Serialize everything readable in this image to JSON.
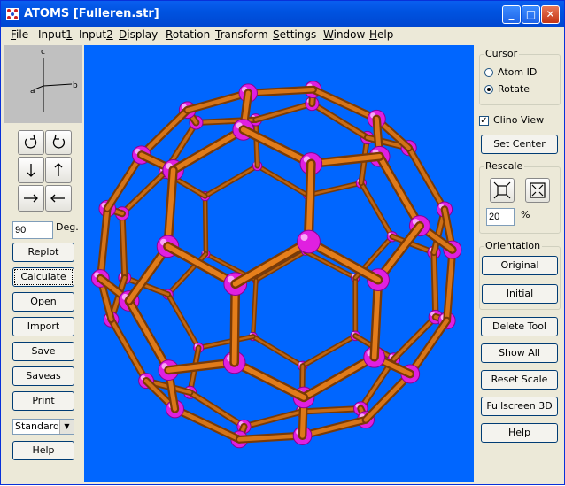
{
  "window": {
    "title": "ATOMS [Fulleren.str]"
  },
  "menu": [
    "File",
    "Input1",
    "Input2",
    "Display",
    "Rotation",
    "Transform",
    "Settings",
    "Window",
    "Help"
  ],
  "menu_underline": [
    "F",
    "1",
    "2",
    "D",
    "R",
    "T",
    "S",
    "W",
    "H"
  ],
  "axes": {
    "a": "a",
    "b": "b",
    "c": "c"
  },
  "left": {
    "angle_value": "90",
    "angle_unit": "Deg.",
    "replot": "Replot",
    "calculate": "Calculate",
    "open": "Open",
    "import": "Import",
    "save": "Save",
    "saveas": "Saveas",
    "print": "Print",
    "mode_select": "Standard",
    "help": "Help"
  },
  "right": {
    "cursor_title": "Cursor",
    "atom_id": "Atom ID",
    "rotate": "Rotate",
    "clino_view": "Clino View",
    "set_center": "Set Center",
    "rescale_title": "Rescale",
    "rescale_value": "20",
    "rescale_unit": "%",
    "orientation_title": "Orientation",
    "original": "Original",
    "initial": "Initial",
    "delete_tool": "Delete Tool",
    "show_all": "Show All",
    "reset_scale": "Reset Scale",
    "fullscreen_3d": "Fullscreen 3D",
    "help": "Help"
  },
  "colors": {
    "viewport_bg": "#0066ff",
    "bond": "#e8801c",
    "atom": "#e020e0"
  }
}
